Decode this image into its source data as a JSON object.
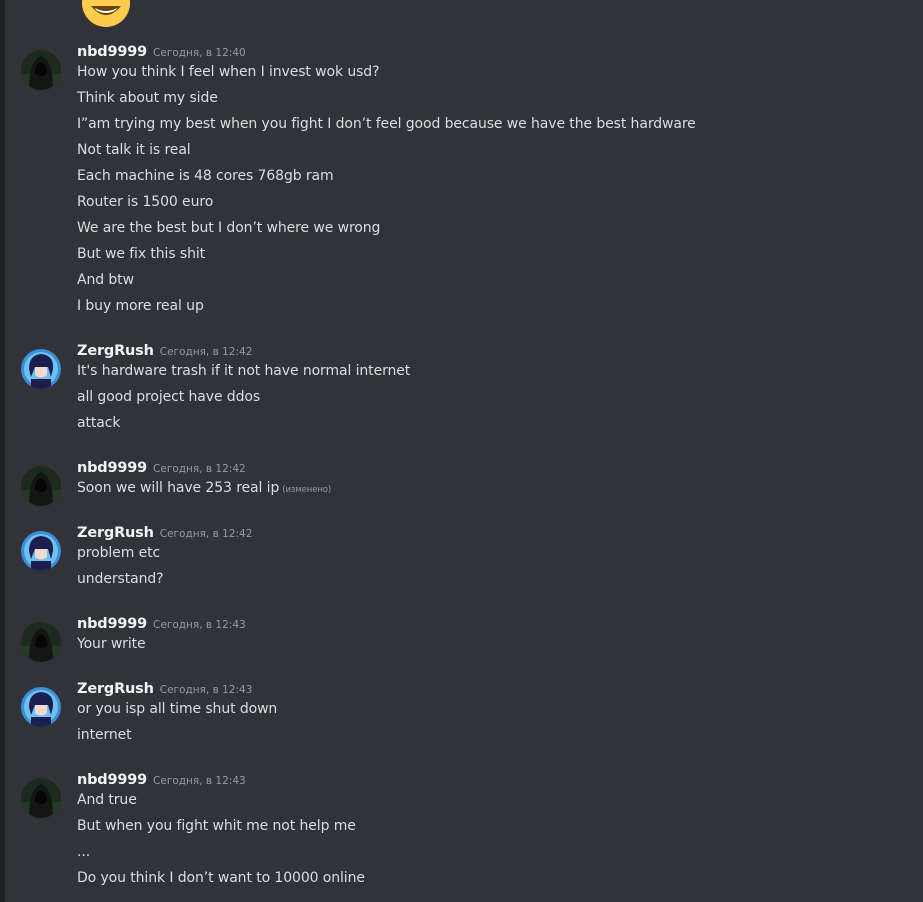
{
  "colors": {
    "background": "#313338",
    "text": "#dbdee1",
    "author": "#f2f3f5",
    "muted": "#949ba4"
  },
  "top_emoji": "smiling-face-with-open-mouth-and-closed-eyes",
  "messages": [
    {
      "author": "nbd9999",
      "timestamp": "Сегодня, в 12:40",
      "avatar": "hooded-figure",
      "lines": [
        "How you think I feel when I invest wok usd?",
        "Think about my side",
        "I”am trying my best when you fight I don’t feel good because we have the best hardware",
        "Not talk it is real",
        "Each machine is 48 cores 768gb ram",
        "Router is 1500 euro",
        "We are the best but I don’t where we wrong",
        "But we fix this shit",
        "And btw",
        "I buy more real up"
      ]
    },
    {
      "author": "ZergRush",
      "timestamp": "Сегодня, в 12:42",
      "avatar": "anime-character",
      "lines": [
        "It's hardware trash if it not have normal internet",
        "all good project have ddos",
        "attack"
      ]
    },
    {
      "author": "nbd9999",
      "timestamp": "Сегодня, в 12:42",
      "avatar": "hooded-figure",
      "lines": [
        "Soon we will have 253 real ip"
      ],
      "edited_label": "(изменено)"
    },
    {
      "author": "ZergRush",
      "timestamp": "Сегодня, в 12:42",
      "avatar": "anime-character",
      "lines": [
        "problem etc",
        "understand?"
      ]
    },
    {
      "author": "nbd9999",
      "timestamp": "Сегодня, в 12:43",
      "avatar": "hooded-figure",
      "lines": [
        "Your write"
      ]
    },
    {
      "author": "ZergRush",
      "timestamp": "Сегодня, в 12:43",
      "avatar": "anime-character",
      "lines": [
        "or you isp all time shut down",
        "internet"
      ]
    },
    {
      "author": "nbd9999",
      "timestamp": "Сегодня, в 12:43",
      "avatar": "hooded-figure",
      "lines": [
        "And true",
        "But when you fight whit me not help me",
        "...",
        "Do you think I don’t want to 10000 online"
      ]
    }
  ]
}
